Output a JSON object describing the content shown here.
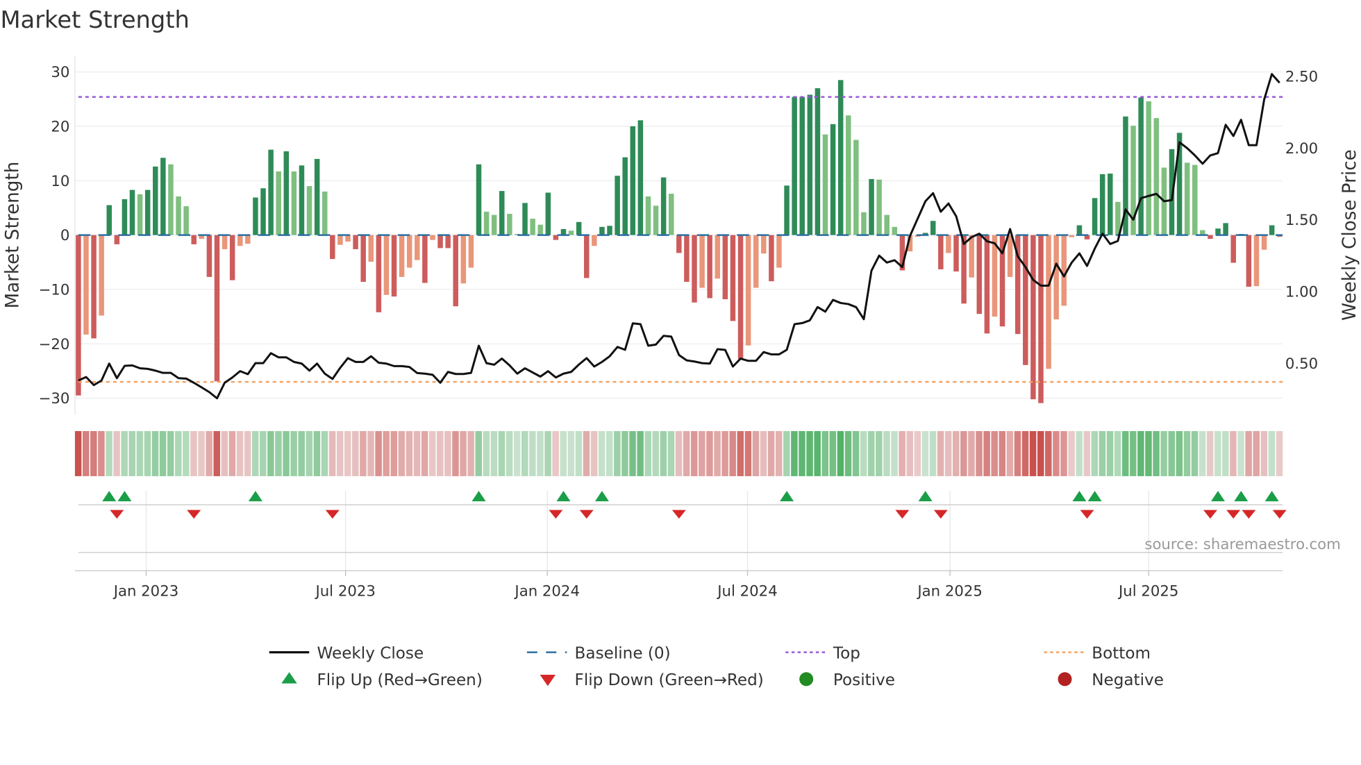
{
  "chart_data": {
    "type": "bar+line",
    "title": "Market Strength",
    "ylabel": "Market Strength",
    "y2label": "Weekly Close Price",
    "ylim": [
      -32.5,
      32
    ],
    "yticks": [
      30,
      20,
      10,
      0,
      -10,
      -20,
      -30
    ],
    "y2ticks": [
      "2.50",
      "2.00",
      "1.50",
      "1.00",
      "0.50"
    ],
    "y2tick_values": [
      2.5,
      2.0,
      1.5,
      1.0,
      0.5
    ],
    "top_level": 25.4,
    "bottom_level": -27,
    "xticks": [
      {
        "label": "Jan 2023",
        "week": 8.8
      },
      {
        "label": "Jul 2023",
        "week": 34.7
      },
      {
        "label": "Jan 2024",
        "week": 60.9
      },
      {
        "label": "Jul 2024",
        "week": 86.9
      },
      {
        "label": "Jan 2025",
        "week": 113.2
      },
      {
        "label": "Jul 2025",
        "week": 139.0
      }
    ],
    "strength": [
      -29.5,
      -18.3,
      -19,
      -14.8,
      5.5,
      -1.7,
      6.6,
      8.3,
      7.5,
      8.3,
      12.6,
      14.2,
      13,
      7.1,
      5.3,
      -1.7,
      -0.7,
      -7.7,
      -26.9,
      -2.6,
      -8.3,
      -2,
      -1.6,
      6.9,
      8.6,
      15.7,
      11.7,
      15.4,
      11.7,
      12.8,
      9,
      14,
      8,
      -4.4,
      -1.8,
      -1.2,
      -2.6,
      -8.6,
      -4.9,
      -14.2,
      -11,
      -11.3,
      -7.7,
      -6,
      -4.6,
      -8.8,
      -0.9,
      -2.4,
      -2.4,
      -13.1,
      -8.9,
      -6,
      13,
      4.3,
      3.7,
      8.1,
      3.9,
      0.2,
      5.9,
      3,
      1.9,
      7.8,
      -0.9,
      1.1,
      0.8,
      2.4,
      -7.9,
      -2,
      1.5,
      1.7,
      10.9,
      14.3,
      20,
      21.1,
      7.1,
      5.4,
      10.6,
      7.6,
      -3.3,
      -8.6,
      -12.4,
      -9.7,
      -11.6,
      -8,
      -11.8,
      -15.8,
      -22.8,
      -20.3,
      -9.7,
      -3.4,
      -8.5,
      -6,
      9.1,
      25.4,
      25.4,
      25.8,
      27,
      18.5,
      20.4,
      28.5,
      22,
      17.5,
      4.2,
      10.3,
      10.2,
      3.7,
      1.5,
      -6.5,
      -3,
      -0.3,
      0.4,
      2.6,
      -6.3,
      -3.3,
      -6.7,
      -12.6,
      -7.8,
      -14.5,
      -18.1,
      -15,
      -16.8,
      -7.7,
      -18.2,
      -23.9,
      -30.2,
      -30.9,
      -24.6,
      -15.5,
      -13,
      -0.4,
      1.8,
      -0.8,
      6.8,
      11.2,
      11.3,
      6.1,
      21.8,
      20.1,
      25.3,
      24.6,
      21.5,
      12.4,
      15.8,
      18.8,
      13.3,
      12.9,
      0.9,
      -0.7,
      1.2,
      2.2,
      -5.1,
      0.2,
      -9.5,
      -9.4,
      -2.7,
      1.8,
      -0.3
    ],
    "weekly_close": [
      0.381,
      0.405,
      0.349,
      0.381,
      0.499,
      0.397,
      0.483,
      0.486,
      0.466,
      0.462,
      0.45,
      0.434,
      0.434,
      0.397,
      0.394,
      0.365,
      0.333,
      0.3,
      0.257,
      0.365,
      0.402,
      0.446,
      0.425,
      0.502,
      0.502,
      0.571,
      0.542,
      0.542,
      0.51,
      0.499,
      0.45,
      0.499,
      0.429,
      0.392,
      0.47,
      0.537,
      0.51,
      0.51,
      0.55,
      0.505,
      0.499,
      0.481,
      0.481,
      0.475,
      0.433,
      0.429,
      0.421,
      0.365,
      0.441,
      0.426,
      0.426,
      0.434,
      0.623,
      0.502,
      0.491,
      0.534,
      0.486,
      0.429,
      0.466,
      0.437,
      0.408,
      0.446,
      0.402,
      0.429,
      0.441,
      0.492,
      0.537,
      0.478,
      0.51,
      0.55,
      0.615,
      0.595,
      0.779,
      0.773,
      0.623,
      0.631,
      0.692,
      0.687,
      0.558,
      0.521,
      0.513,
      0.502,
      0.499,
      0.599,
      0.594,
      0.478,
      0.534,
      0.518,
      0.518,
      0.579,
      0.563,
      0.563,
      0.595,
      0.773,
      0.781,
      0.8,
      0.893,
      0.861,
      0.942,
      0.921,
      0.913,
      0.892,
      0.808,
      1.146,
      1.251,
      1.203,
      1.219,
      1.171,
      1.388,
      1.509,
      1.63,
      1.686,
      1.557,
      1.614,
      1.525,
      1.332,
      1.38,
      1.404,
      1.351,
      1.337,
      1.267,
      1.436,
      1.246,
      1.171,
      1.082,
      1.042,
      1.042,
      1.195,
      1.106,
      1.203,
      1.267,
      1.179,
      1.3,
      1.404,
      1.332,
      1.353,
      1.573,
      1.501,
      1.651,
      1.667,
      1.681,
      1.63,
      1.638,
      2.041,
      2.0,
      1.949,
      1.891,
      1.949,
      1.965,
      2.162,
      2.084,
      2.197,
      2.02,
      2.02,
      2.339,
      2.516,
      2.455
    ],
    "legend": [
      {
        "label": "Weekly Close",
        "kind": "line"
      },
      {
        "label": "Baseline (0)",
        "kind": "dashed"
      },
      {
        "label": "Top",
        "kind": "dotted-top"
      },
      {
        "label": "Bottom",
        "kind": "dotted-bottom"
      },
      {
        "label": "Flip Up (Red→Green)",
        "kind": "tri-up"
      },
      {
        "label": "Flip Down (Green→Red)",
        "kind": "tri-down"
      },
      {
        "label": "Positive",
        "kind": "dot-pos"
      },
      {
        "label": "Negative",
        "kind": "dot-neg"
      }
    ],
    "legend_placement": "bottom",
    "grid": true,
    "source": "source: sharemaestro.com"
  },
  "colors": {
    "green_dark": "#2e8b57",
    "green_light": "#7fbf7f",
    "red_dark": "#cd5c5c",
    "red_light": "#e9967a",
    "line": "#111111",
    "baseline": "#2c6fa0",
    "top": "#9b59d6",
    "bottom": "#f4a261",
    "flip_up": "#1a9e47",
    "flip_down": "#d62728",
    "positive": "#228b22",
    "negative": "#b22222"
  }
}
